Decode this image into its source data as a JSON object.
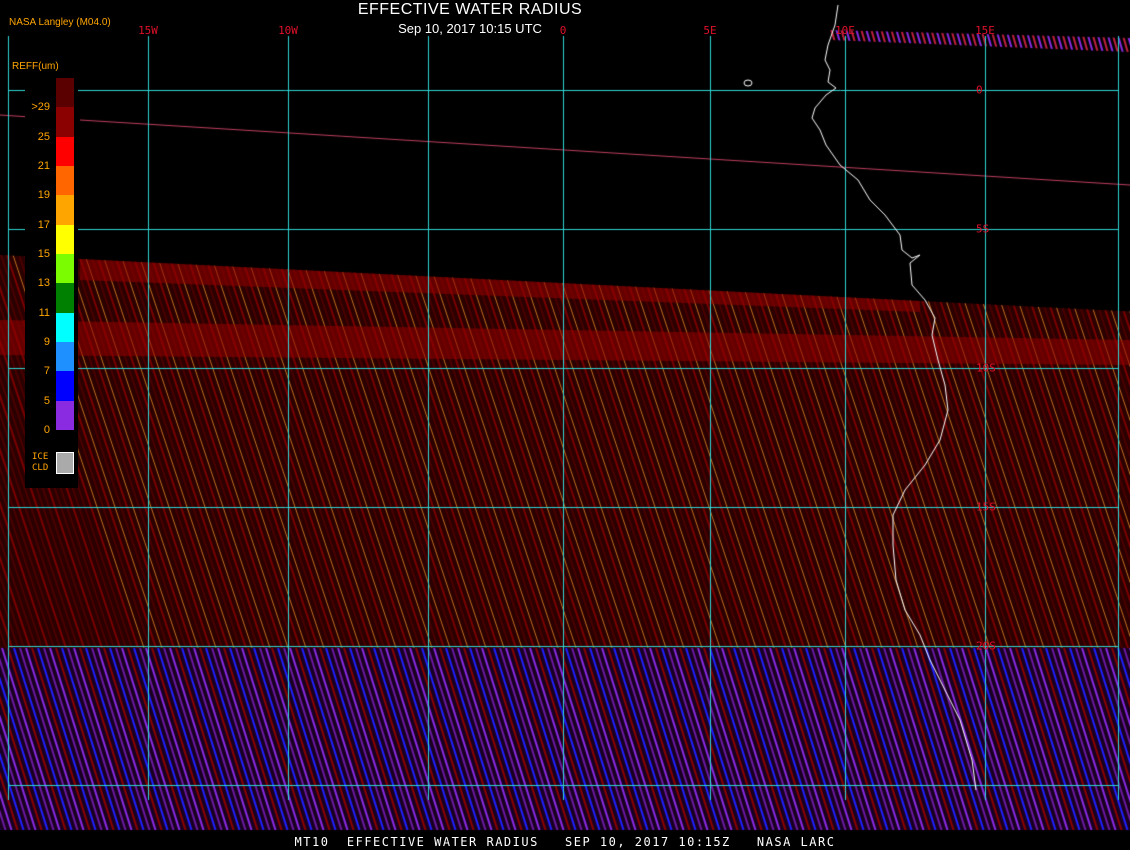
{
  "title": "EFFECTIVE WATER RADIUS",
  "subtitle": "Sep 10, 2017 10:15 UTC",
  "producer": "NASA Langley (M04.0)",
  "footer": "MT10  EFFECTIVE WATER RADIUS   SEP 10, 2017 10:15Z   NASA LARC",
  "legend": {
    "title": "REFF(um)",
    "colors": [
      "#8a2be2",
      "#0000ff",
      "#1e90ff",
      "#00ffff",
      "#008000",
      "#7cfc00",
      "#ffff00",
      "#ffa500",
      "#ff6600",
      "#ff0000",
      "#8b0000",
      "#5a0000"
    ],
    "ticks": [
      "0",
      "5",
      "7",
      "9",
      "11",
      "13",
      "15",
      "17",
      "19",
      "21",
      "25",
      ">29"
    ],
    "ice_label": "ICE\nCLD",
    "ice_color": "#aaaaaa"
  },
  "grid": {
    "line_color": "#2fd6d6",
    "label_color": "#e0102a",
    "lon_labels": [
      "15W",
      "10W",
      "0",
      "5E",
      "10E",
      "15E"
    ],
    "lat_labels": [
      "0",
      "5S",
      "10S",
      "15S",
      "20S"
    ]
  },
  "coastline_color": "#ffffff",
  "cloud_palette": [
    "#6a0000",
    "#8b0000",
    "#9b1010",
    "#ffa500",
    "#8a2be2",
    "#0000ff"
  ]
}
